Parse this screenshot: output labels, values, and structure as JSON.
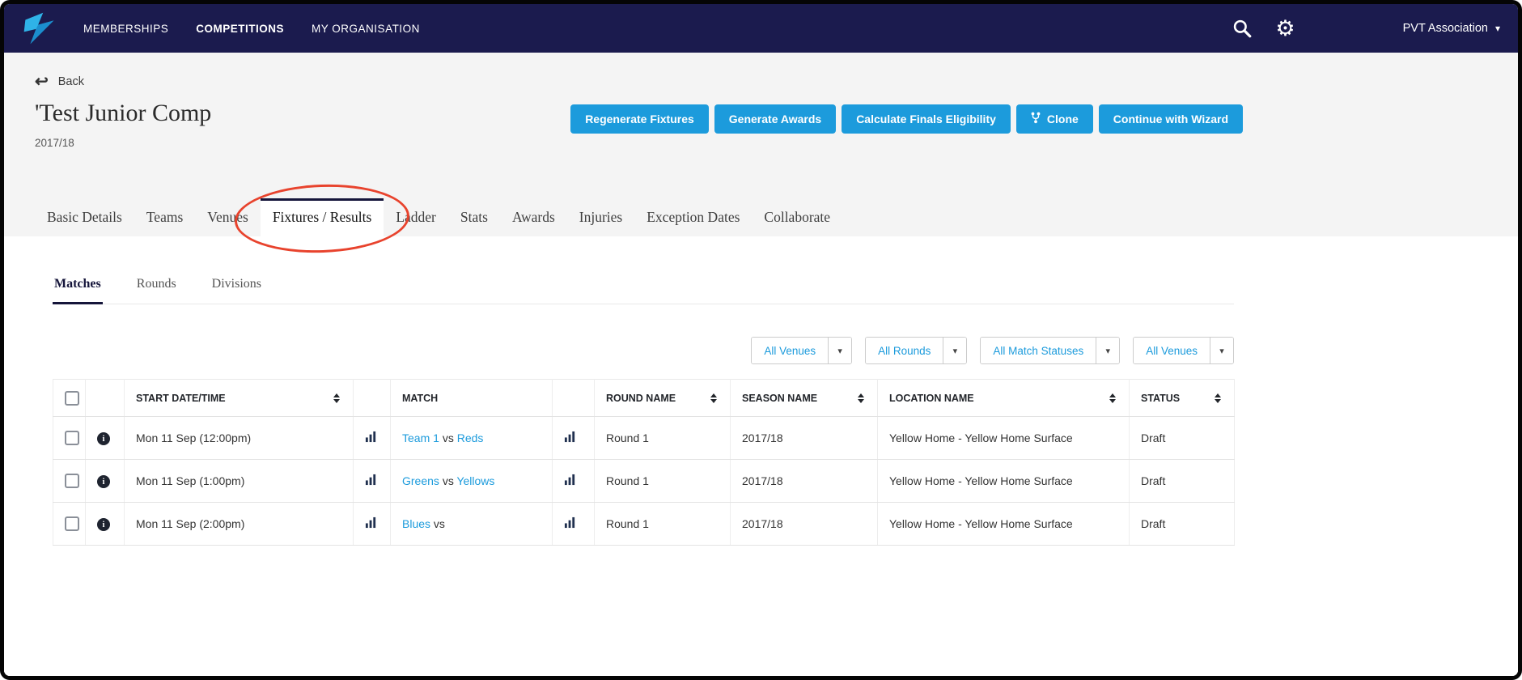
{
  "colors": {
    "navy": "#1b1b4e",
    "accent": "#1c9bdc",
    "page_bg": "#f4f4f4",
    "annotation_red": "#e8432d",
    "link": "#1c9bdc"
  },
  "icons": {
    "gear": "⚙",
    "caret_down": "▾",
    "back": "↩",
    "info": "i"
  },
  "navbar": {
    "items": [
      "MEMBERSHIPS",
      "COMPETITIONS",
      "MY ORGANISATION"
    ],
    "org_label": "PVT Association"
  },
  "page": {
    "back_label": "Back",
    "title": "'Test Junior Comp",
    "season": "2017/18",
    "actions": [
      "Regenerate Fixtures",
      "Generate Awards",
      "Calculate Finals Eligibility",
      "Clone",
      "Continue with Wizard"
    ]
  },
  "tabs": [
    "Basic Details",
    "Teams",
    "Venues",
    "Fixtures / Results",
    "Ladder",
    "Stats",
    "Awards",
    "Injuries",
    "Exception Dates",
    "Collaborate"
  ],
  "subtabs": [
    "Matches",
    "Rounds",
    "Divisions"
  ],
  "filters": [
    "All Venues",
    "All Rounds",
    "All Match Statuses",
    "All Venues"
  ],
  "table": {
    "headers": [
      "START DATE/TIME",
      "MATCH",
      "ROUND NAME",
      "SEASON NAME",
      "LOCATION NAME",
      "STATUS"
    ],
    "rows": [
      {
        "start": "Mon 11 Sep (12:00pm)",
        "home": "Team 1",
        "vs": "vs",
        "away": "Reds",
        "round": "Round 1",
        "season": "2017/18",
        "location": "Yellow Home - Yellow Home Surface",
        "status": "Draft"
      },
      {
        "start": "Mon 11 Sep (1:00pm)",
        "home": "Greens",
        "vs": "vs",
        "away": "Yellows",
        "round": "Round 1",
        "season": "2017/18",
        "location": "Yellow Home - Yellow Home Surface",
        "status": "Draft"
      },
      {
        "start": "Mon 11 Sep (2:00pm)",
        "home": "Blues",
        "vs": "vs",
        "away": "",
        "round": "Round 1",
        "season": "2017/18",
        "location": "Yellow Home - Yellow Home Surface",
        "status": "Draft"
      }
    ]
  }
}
